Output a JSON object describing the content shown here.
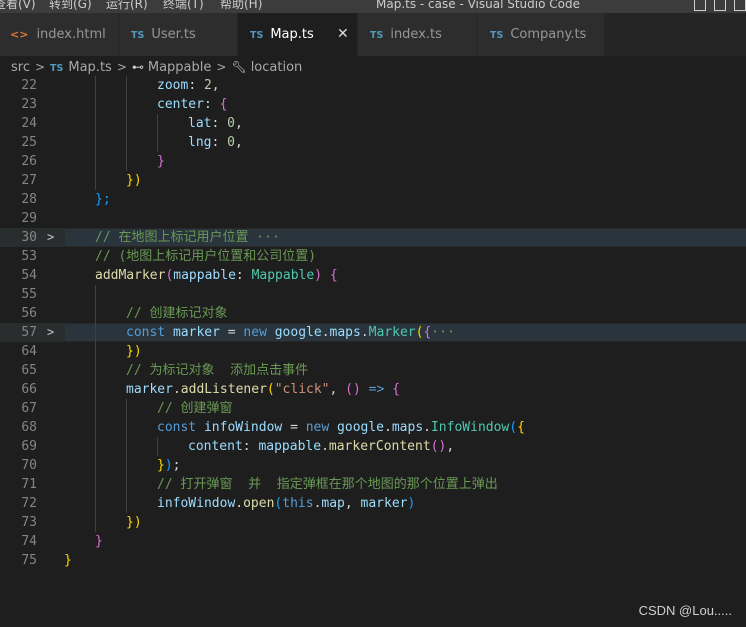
{
  "menubar": {
    "items": [
      "查看(V)",
      "转到(G)",
      "运行(R)",
      "终端(T)",
      "帮助(H)"
    ]
  },
  "window_title": "Map.ts - case - Visual Studio Code",
  "tabs": [
    {
      "label": "index.html",
      "icon": "html-file-icon",
      "active": false
    },
    {
      "label": "User.ts",
      "icon": "ts-file-icon",
      "active": false
    },
    {
      "label": "Map.ts",
      "icon": "ts-file-icon",
      "active": true
    },
    {
      "label": "index.ts",
      "icon": "ts-file-icon",
      "active": false
    },
    {
      "label": "Company.ts",
      "icon": "ts-file-icon",
      "active": false
    }
  ],
  "tab_icon_text": {
    "ts": "TS",
    "html": "<>",
    "close": "✕"
  },
  "breadcrumb": {
    "src": "src",
    "file": "Map.ts",
    "symbol1": "Mappable",
    "symbol2": "location"
  },
  "code_lines": [
    {
      "num": "22",
      "fold": ""
    },
    {
      "num": "23",
      "fold": ""
    },
    {
      "num": "24",
      "fold": ""
    },
    {
      "num": "25",
      "fold": ""
    },
    {
      "num": "26",
      "fold": ""
    },
    {
      "num": "27",
      "fold": ""
    },
    {
      "num": "28",
      "fold": ""
    },
    {
      "num": "29",
      "fold": ""
    },
    {
      "num": "30",
      "fold": ">"
    },
    {
      "num": "53",
      "fold": ""
    },
    {
      "num": "54",
      "fold": ""
    },
    {
      "num": "55",
      "fold": ""
    },
    {
      "num": "56",
      "fold": ""
    },
    {
      "num": "57",
      "fold": ">"
    },
    {
      "num": "64",
      "fold": ""
    },
    {
      "num": "65",
      "fold": ""
    },
    {
      "num": "66",
      "fold": ""
    },
    {
      "num": "67",
      "fold": ""
    },
    {
      "num": "68",
      "fold": ""
    },
    {
      "num": "69",
      "fold": ""
    },
    {
      "num": "70",
      "fold": ""
    },
    {
      "num": "71",
      "fold": ""
    },
    {
      "num": "72",
      "fold": ""
    },
    {
      "num": "73",
      "fold": ""
    },
    {
      "num": "74",
      "fold": ""
    },
    {
      "num": "75",
      "fold": ""
    }
  ],
  "code_text": {
    "l22_a": "zoom",
    "l22_b": ": ",
    "l22_c": "2",
    "l22_d": ",",
    "l23_a": "center",
    "l23_b": ": ",
    "l23_c": "{",
    "l24_a": "lat",
    "l24_b": ": ",
    "l24_c": "0",
    "l24_d": ",",
    "l25_a": "lng",
    "l25_b": ": ",
    "l25_c": "0",
    "l25_d": ",",
    "l26_a": "}",
    "l27_a": "})",
    "l28_a": "};",
    "l30_a": "// 在地图上标记用户位置",
    "l30_b": " ···",
    "l53_a": "// (地图上标记用户位置和公司位置)",
    "l54_a": "addMarker",
    "l54_b": "(",
    "l54_c": "mappable",
    "l54_d": ": ",
    "l54_e": "Mappable",
    "l54_f": ") ",
    "l54_g": "{",
    "l56_a": "// 创建标记对象",
    "l57_a": "const",
    "l57_b": " ",
    "l57_c": "marker",
    "l57_d": " = ",
    "l57_e": "new",
    "l57_f": " ",
    "l57_g": "google",
    "l57_h": ".",
    "l57_i": "maps",
    "l57_j": ".",
    "l57_k": "Marker",
    "l57_l": "(",
    "l57_m": "{",
    "l57_n": "···",
    "l64_a": "})",
    "l65_a": "// 为标记对象  添加点击事件",
    "l66_a": "marker",
    "l66_b": ".",
    "l66_c": "addListener",
    "l66_d": "(",
    "l66_e": "\"click\"",
    "l66_f": ", ",
    "l66_g": "()",
    "l66_h": " ",
    "l66_i": "=>",
    "l66_j": " ",
    "l66_k": "{",
    "l67_a": "// 创建弹窗",
    "l68_a": "const",
    "l68_b": " ",
    "l68_c": "infoWindow",
    "l68_d": " = ",
    "l68_e": "new",
    "l68_f": " ",
    "l68_g": "google",
    "l68_h": ".",
    "l68_i": "maps",
    "l68_j": ".",
    "l68_k": "InfoWindow",
    "l68_l": "(",
    "l68_m": "{",
    "l69_a": "content",
    "l69_b": ": ",
    "l69_c": "mappable",
    "l69_d": ".",
    "l69_e": "markerContent",
    "l69_f": "()",
    "l69_g": ",",
    "l70_a": "}",
    "l70_b": ")",
    "l70_c": ";",
    "l71_a": "// 打开弹窗  并  指定弹框在那个地图的那个位置上弹出",
    "l72_a": "infoWindow",
    "l72_b": ".",
    "l72_c": "open",
    "l72_d": "(",
    "l72_e": "this",
    "l72_f": ".",
    "l72_g": "map",
    "l72_h": ", ",
    "l72_i": "marker",
    "l72_j": ")",
    "l73_a": "})",
    "l74_a": "}",
    "l75_a": "}"
  },
  "watermark": "CSDN @Lou.....",
  "colors": {
    "background": "#1e1e1e",
    "comment": "#6a9955",
    "keyword": "#569cd6",
    "function": "#dcdcaa",
    "variable": "#9cdcfe",
    "type": "#4ec9b0",
    "number": "#b5cea8",
    "string": "#ce9178"
  }
}
